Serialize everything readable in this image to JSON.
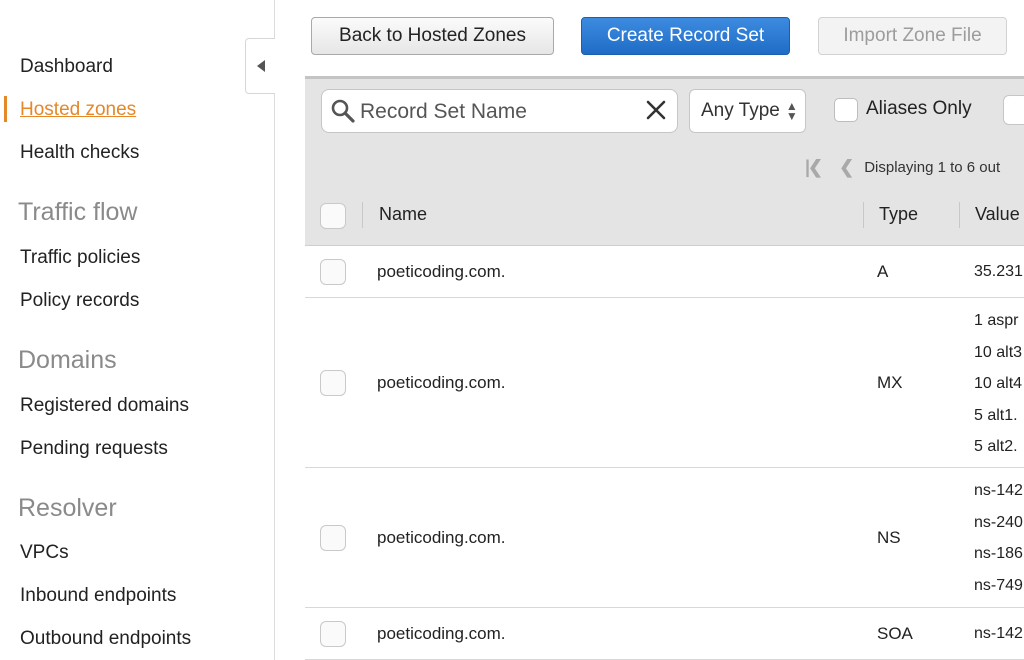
{
  "sidebar": {
    "items": [
      {
        "label": "Dashboard"
      },
      {
        "label": "Hosted zones"
      },
      {
        "label": "Health checks"
      },
      {
        "label": "Traffic policies"
      },
      {
        "label": "Policy records"
      },
      {
        "label": "Registered domains"
      },
      {
        "label": "Pending requests"
      },
      {
        "label": "VPCs"
      },
      {
        "label": "Inbound endpoints"
      },
      {
        "label": "Outbound endpoints"
      }
    ],
    "headings": [
      "Traffic flow",
      "Domains",
      "Resolver"
    ],
    "active_color": "#e4882a"
  },
  "toolbar": {
    "back_label": "Back to Hosted Zones",
    "create_label": "Create Record Set",
    "import_label": "Import Zone File"
  },
  "filter": {
    "search_placeholder": "Record Set Name",
    "type_select": "Any Type",
    "aliases_label": "Aliases Only",
    "pager_text": "Displaying 1 to 6 out"
  },
  "table": {
    "columns": [
      "Name",
      "Type",
      "Value"
    ],
    "rows": [
      {
        "name": "poeticoding.com.",
        "type": "A",
        "values": [
          "35.231"
        ]
      },
      {
        "name": "poeticoding.com.",
        "type": "MX",
        "values": [
          "1 aspr",
          "10 alt3",
          "10 alt4",
          "5 alt1.",
          "5 alt2."
        ]
      },
      {
        "name": "poeticoding.com.",
        "type": "NS",
        "values": [
          "ns-142",
          "ns-240",
          "ns-186",
          "ns-749"
        ]
      },
      {
        "name": "poeticoding.com.",
        "type": "SOA",
        "values": [
          "ns-142"
        ]
      }
    ]
  },
  "colors": {
    "primary_button": "#1f6cc6",
    "panel_bg": "#e4e4e4"
  }
}
